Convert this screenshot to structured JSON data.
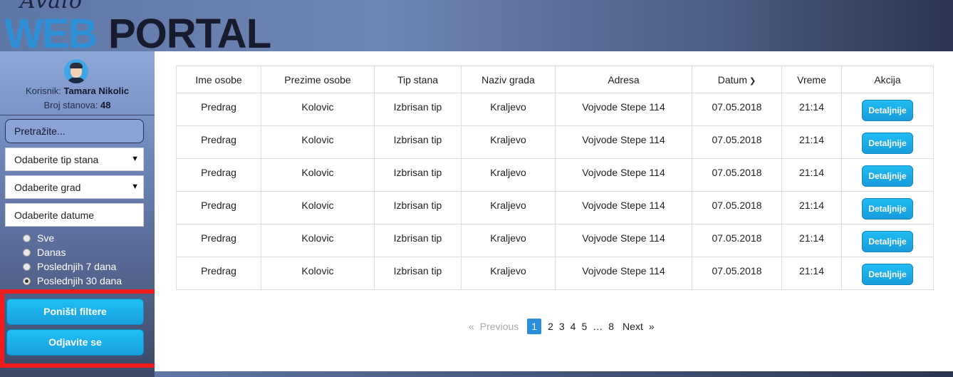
{
  "header": {
    "logo_script": "Avalo",
    "logo_web": "WEB",
    "logo_portal": "PORTAL"
  },
  "sidebar": {
    "user_label": "Korisnik:",
    "user_name": "Tamara Nikolic",
    "count_label": "Broj stanova:",
    "count_value": "48",
    "search_placeholder": "Pretražite...",
    "type_select": "Odaberite tip stana",
    "city_select": "Odaberite grad",
    "date_select": "Odaberite datume",
    "radios": [
      {
        "label": "Sve",
        "checked": false
      },
      {
        "label": "Danas",
        "checked": false
      },
      {
        "label": "Poslednjih 7 dana",
        "checked": false
      },
      {
        "label": "Poslednjih 30 dana",
        "checked": true
      }
    ],
    "reset_label": "Poništi filtere",
    "logout_label": "Odjavite se"
  },
  "annotation": {
    "color": "#f21a1a"
  },
  "table": {
    "headers": [
      "Ime osobe",
      "Prezime osobe",
      "Tip stana",
      "Naziv grada",
      "Adresa",
      "Datum",
      "Vreme",
      "Akcija"
    ],
    "sort_icon": "chevron-down-icon",
    "rows": [
      {
        "ime": "Predrag",
        "prezime": "Kolovic",
        "tip": "Izbrisan tip",
        "grad": "Kraljevo",
        "adresa": "Vojvode Stepe 114",
        "datum": "07.05.2018",
        "vreme": "21:14",
        "akcija": "Detaljnije"
      },
      {
        "ime": "Predrag",
        "prezime": "Kolovic",
        "tip": "Izbrisan tip",
        "grad": "Kraljevo",
        "adresa": "Vojvode Stepe 114",
        "datum": "07.05.2018",
        "vreme": "21:14",
        "akcija": "Detaljnije"
      },
      {
        "ime": "Predrag",
        "prezime": "Kolovic",
        "tip": "Izbrisan tip",
        "grad": "Kraljevo",
        "adresa": "Vojvode Stepe 114",
        "datum": "07.05.2018",
        "vreme": "21:14",
        "akcija": "Detaljnije"
      },
      {
        "ime": "Predrag",
        "prezime": "Kolovic",
        "tip": "Izbrisan tip",
        "grad": "Kraljevo",
        "adresa": "Vojvode Stepe 114",
        "datum": "07.05.2018",
        "vreme": "21:14",
        "akcija": "Detaljnije"
      },
      {
        "ime": "Predrag",
        "prezime": "Kolovic",
        "tip": "Izbrisan tip",
        "grad": "Kraljevo",
        "adresa": "Vojvode Stepe 114",
        "datum": "07.05.2018",
        "vreme": "21:14",
        "akcija": "Detaljnije"
      },
      {
        "ime": "Predrag",
        "prezime": "Kolovic",
        "tip": "Izbrisan tip",
        "grad": "Kraljevo",
        "adresa": "Vojvode Stepe 114",
        "datum": "07.05.2018",
        "vreme": "21:14",
        "akcija": "Detaljnije"
      }
    ]
  },
  "pagination": {
    "first": "«",
    "previous": "Previous",
    "pages": [
      "1",
      "2",
      "3",
      "4",
      "5",
      "…",
      "8"
    ],
    "active_page": "1",
    "next": "Next",
    "last": "»"
  }
}
